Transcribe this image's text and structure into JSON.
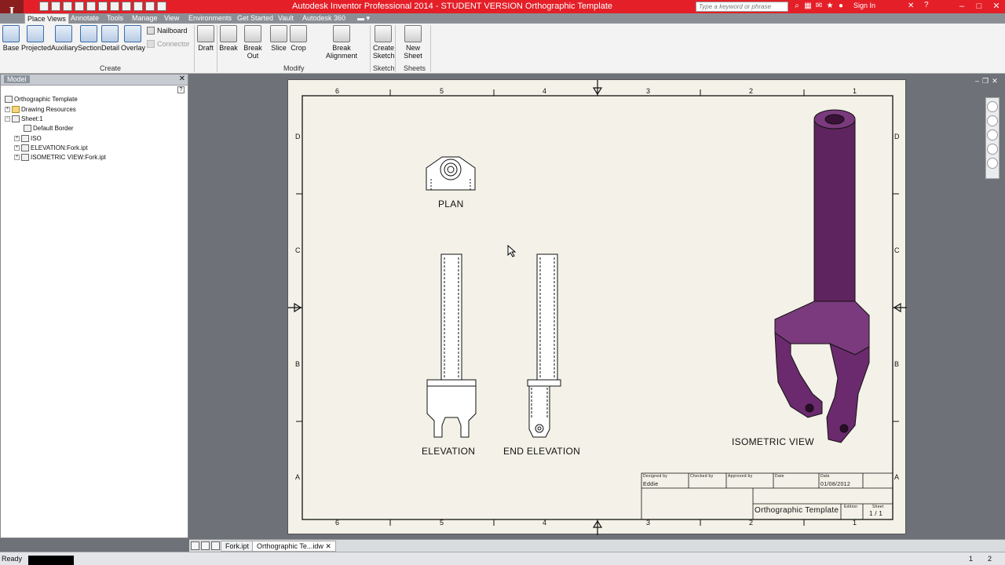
{
  "app": {
    "logo": "I",
    "title": "Autodesk Inventor Professional 2014 - STUDENT VERSION   Orthographic Template",
    "search_placeholder": "Type a keyword or phrase",
    "sign_in": "Sign In"
  },
  "ribbon_tabs": [
    "Place Views",
    "Annotate",
    "Tools",
    "Manage",
    "View",
    "Environments",
    "Get Started",
    "Vault",
    "Autodesk 360"
  ],
  "ribbon": {
    "create": {
      "group_label": "Create",
      "buttons": [
        "Base",
        "Projected",
        "Auxiliary",
        "Section",
        "Detail",
        "Overlay"
      ],
      "small": [
        "Nailboard",
        "Connector"
      ]
    },
    "modify": {
      "group_label": "Modify",
      "buttons": [
        "Draft",
        "Break",
        "Break Out",
        "Slice",
        "Crop",
        "Break Alignment"
      ]
    },
    "sketch": {
      "group_label": "Sketch",
      "button_line1": "Create",
      "button_line2": "Sketch"
    },
    "sheets": {
      "group_label": "Sheets",
      "button": "New Sheet"
    }
  },
  "browser": {
    "title": "Model",
    "nodes": [
      {
        "label": "Orthographic Template"
      },
      {
        "label": "Drawing Resources"
      },
      {
        "label": "Sheet:1"
      },
      {
        "label": "Default Border"
      },
      {
        "label": "ISO"
      },
      {
        "label": "ELEVATION:Fork.ipt"
      },
      {
        "label": "ISOMETRIC VIEW:Fork.ipt"
      }
    ]
  },
  "sheet": {
    "zone_numbers_top": [
      "6",
      "5",
      "4",
      "3",
      "2",
      "1"
    ],
    "zone_numbers_bottom": [
      "6",
      "5",
      "4",
      "3",
      "2",
      "1"
    ],
    "zone_letters": [
      "D",
      "C",
      "B",
      "A"
    ],
    "views": {
      "plan": "PLAN",
      "elevation": "ELEVATION",
      "end_elevation": "END ELEVATION",
      "isometric": "ISOMETRIC VIEW"
    },
    "title_block": {
      "designed_by_label": "Designed by",
      "designed_by": "Eddie",
      "checked_by_label": "Checked by",
      "approved_by_label": "Approved by",
      "date_label": "Date",
      "date_label2": "Date",
      "date": "01/08/2012",
      "title": "Orthographic Template",
      "edition_label": "Edition",
      "sheet_label": "Sheet",
      "sheet_value": "1 / 1"
    }
  },
  "doc_tabs": [
    "Fork.ipt",
    "Orthographic Te...idw"
  ],
  "status": {
    "text": "Ready",
    "n1": "1",
    "n2": "2"
  },
  "colors": {
    "title_bar": "#e41f28",
    "iso_part": "#6b2a6e"
  }
}
